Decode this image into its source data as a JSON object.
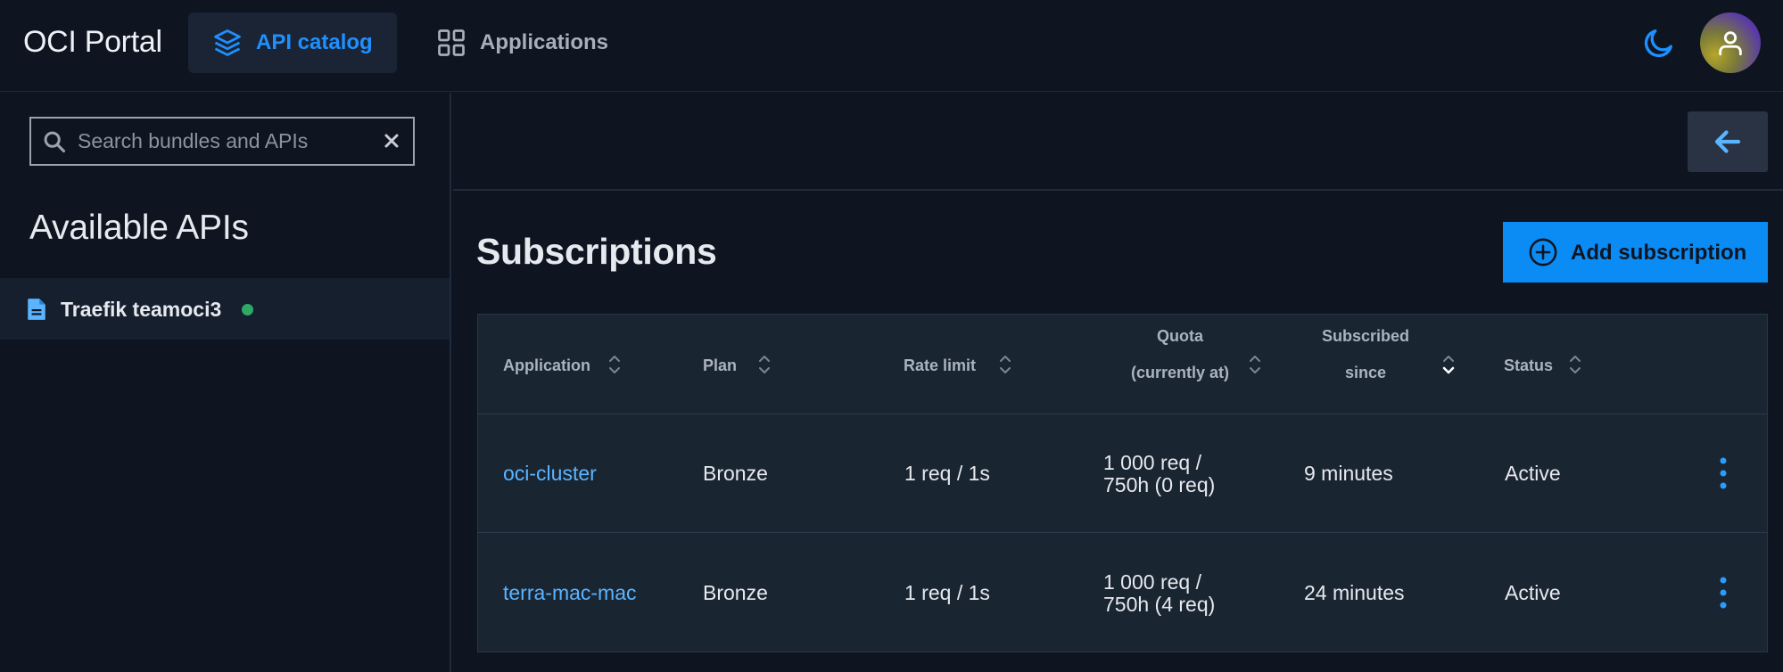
{
  "header": {
    "brand": "OCI Portal",
    "tabs": [
      {
        "label": "API catalog",
        "icon": "layers-icon",
        "active": true
      },
      {
        "label": "Applications",
        "icon": "grid-icon",
        "active": false
      }
    ],
    "theme_icon": "moon-icon",
    "avatar_icon": "user-icon"
  },
  "sidebar": {
    "search": {
      "placeholder": "Search bundles and APIs",
      "value": ""
    },
    "title": "Available APIs",
    "items": [
      {
        "label": "Traefik teamoci3",
        "icon": "document-icon",
        "status_color": "#2ea866"
      }
    ]
  },
  "main": {
    "back_icon": "arrow-left-icon",
    "title": "Subscriptions",
    "add_button": "Add subscription",
    "table": {
      "columns": [
        {
          "line1": "Application",
          "line2": ""
        },
        {
          "line1": "Plan",
          "line2": ""
        },
        {
          "line1": "Rate limit",
          "line2": ""
        },
        {
          "line1": "Quota",
          "line2": "(currently at)"
        },
        {
          "line1": "Subscribed",
          "line2": "since"
        },
        {
          "line1": "Status",
          "line2": ""
        }
      ],
      "rows": [
        {
          "application": "oci-cluster",
          "plan": "Bronze",
          "rate_limit": "1 req / 1s",
          "quota_line1": "1 000 req /",
          "quota_line2": "750h (0 req)",
          "since": "9 minutes",
          "status": "Active"
        },
        {
          "application": "terra-mac-mac",
          "plan": "Bronze",
          "rate_limit": "1 req / 1s",
          "quota_line1": "1 000 req /",
          "quota_line2": "750h (4 req)",
          "since": "24 minutes",
          "status": "Active"
        }
      ]
    }
  },
  "colors": {
    "accent": "#1e90ff",
    "link": "#5ab4ff",
    "button": "#0b8cf5",
    "background": "#0e1521",
    "status_dot": "#2ea866"
  }
}
